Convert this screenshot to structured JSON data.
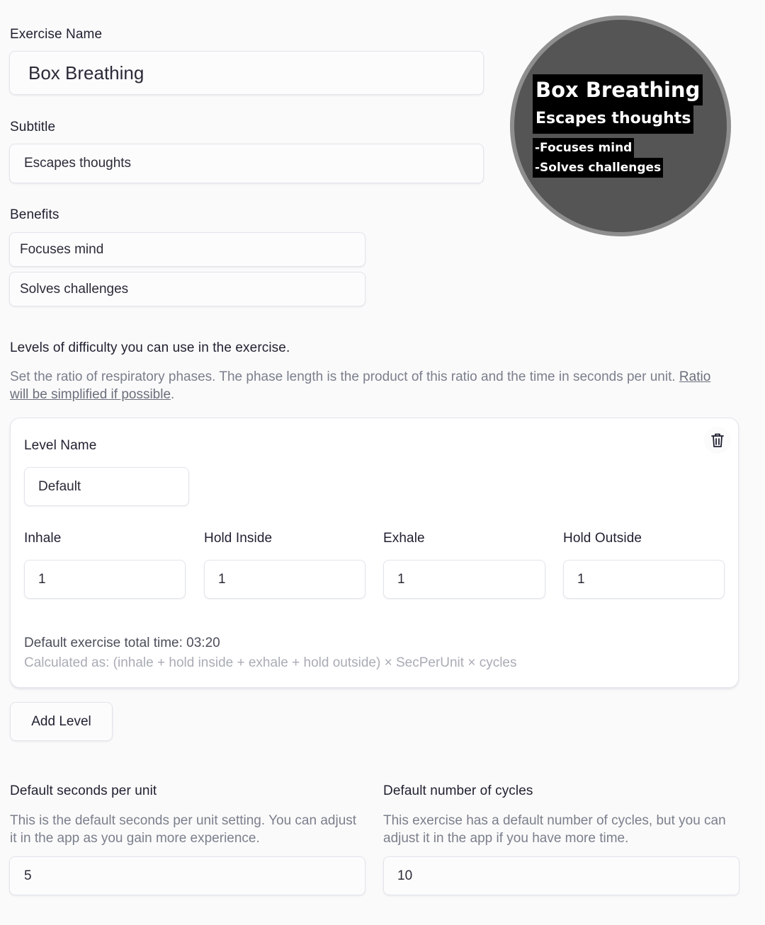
{
  "exercise_name": {
    "label": "Exercise Name",
    "value": "Box Breathing"
  },
  "subtitle": {
    "label": "Subtitle",
    "value": "Escapes thoughts"
  },
  "benefits": {
    "label": "Benefits",
    "items": [
      "Focuses mind",
      "Solves challenges"
    ]
  },
  "preview": {
    "title": "Box Breathing",
    "subtitle": "Escapes thoughts",
    "benefits": [
      "-Focuses mind",
      "-Solves challenges"
    ],
    "colors": {
      "circle": "#555555",
      "ring": "#8e8e8e",
      "highlight": "#000000",
      "text": "#ffffff"
    }
  },
  "levels": {
    "heading": "Levels of difficulty you can use in the exercise.",
    "description": "Set the ratio of respiratory phases. The phase length is the product of this ratio and the time in seconds per unit.",
    "description_link": "Ratio will be simplified if possible",
    "description_end": ".",
    "items": [
      {
        "name_label": "Level Name",
        "name_value": "Default",
        "delete_icon": "trash-icon",
        "phases": [
          {
            "label": "Inhale",
            "value": "1"
          },
          {
            "label": "Hold Inside",
            "value": "1"
          },
          {
            "label": "Exhale",
            "value": "1"
          },
          {
            "label": "Hold Outside",
            "value": "1"
          }
        ],
        "total_time": "Default exercise total time: 03:20",
        "formula": "Calculated as: (inhale + hold inside + exhale + hold outside) × SecPerUnit × cycles"
      }
    ],
    "add_label": "Add Level"
  },
  "seconds_per_unit": {
    "label": "Default seconds per unit",
    "help": "This is the default seconds per unit setting. You can adjust it in the app as you gain more experience.",
    "value": "5"
  },
  "cycles": {
    "label": "Default number of cycles",
    "help": "This exercise has a default number of cycles, but you can adjust it in the app if you have more time.",
    "value": "10"
  }
}
